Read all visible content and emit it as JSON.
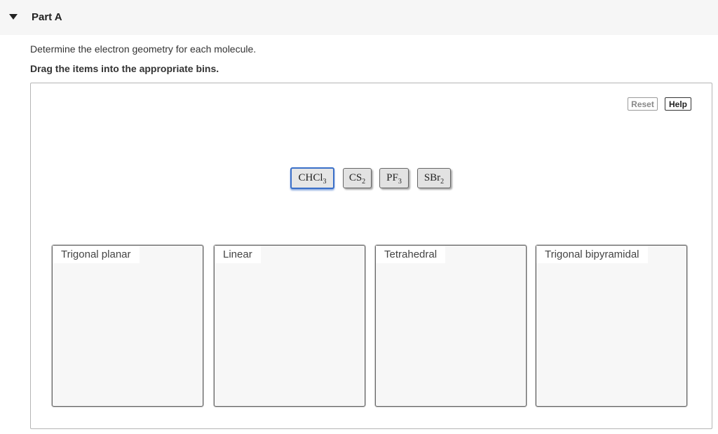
{
  "part": {
    "title": "Part A"
  },
  "question": {
    "instruction": "Determine the electron geometry for each molecule.",
    "directive": "Drag the items into the appropriate bins."
  },
  "toolbar": {
    "reset_label": "Reset",
    "help_label": "Help"
  },
  "tokens": [
    {
      "base": "CHCl",
      "sub": "3",
      "selected": true
    },
    {
      "base": "CS",
      "sub": "2",
      "selected": false
    },
    {
      "base": "PF",
      "sub": "3",
      "selected": false
    },
    {
      "base": "SBr",
      "sub": "2",
      "selected": false
    }
  ],
  "bins": [
    {
      "label": "Trigonal planar"
    },
    {
      "label": "Linear"
    },
    {
      "label": "Tetrahedral"
    },
    {
      "label": "Trigonal bipyramidal"
    }
  ],
  "colors": {
    "selected_border": "#3a6fc8",
    "bin_background": "#f7f7f7",
    "header_background": "#f6f6f6"
  },
  "icons": {
    "toggle": "caret-down-icon"
  }
}
